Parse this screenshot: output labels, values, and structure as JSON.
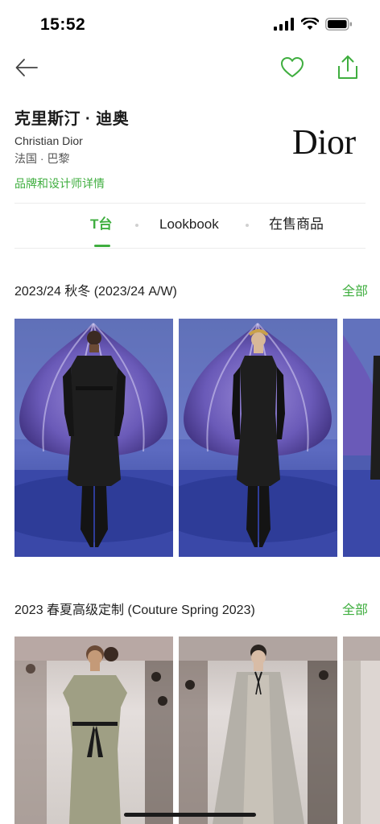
{
  "status": {
    "time": "15:52"
  },
  "brand": {
    "name_cn": "克里斯汀 · 迪奥",
    "name_en": "Christian Dior",
    "location": "法国 · 巴黎",
    "detail_link": "品牌和设计师详情",
    "logo_text": "Dior"
  },
  "tabs": [
    {
      "label": "T台",
      "active": true
    },
    {
      "label": "Lookbook",
      "active": false
    },
    {
      "label": "在售商品",
      "active": false
    }
  ],
  "sections": [
    {
      "title": "2023/24 秋冬 (2023/24 A/W)",
      "all_label": "全部"
    },
    {
      "title": "2023 春夏高级定制 (Couture Spring 2023)",
      "all_label": "全部"
    }
  ],
  "colors": {
    "accent": "#3fae3f"
  }
}
